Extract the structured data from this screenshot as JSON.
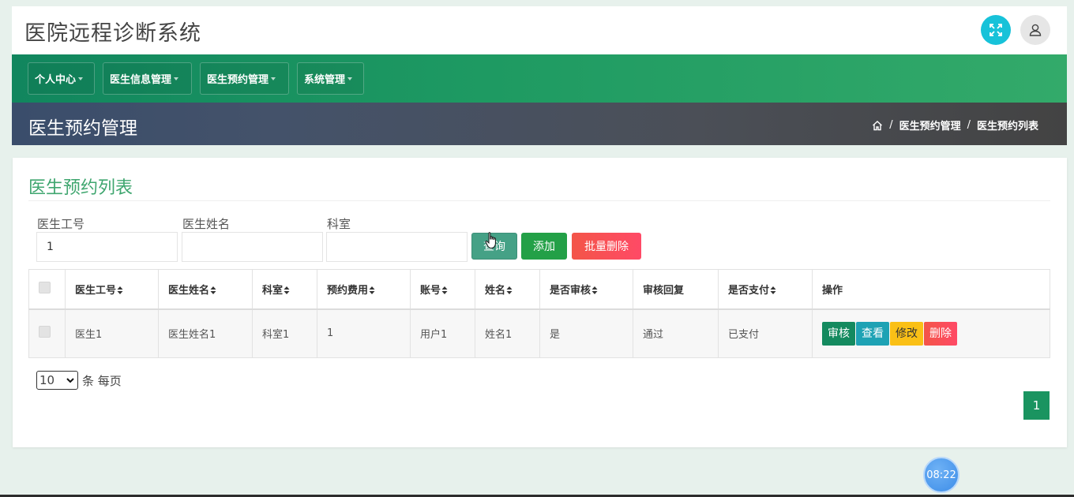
{
  "app": {
    "title": "医院远程诊断系统"
  },
  "nav": {
    "items": [
      {
        "label": "个人中心"
      },
      {
        "label": "医生信息管理"
      },
      {
        "label": "医生预约管理"
      },
      {
        "label": "系统管理"
      }
    ]
  },
  "page_header": {
    "title": "医生预约管理",
    "breadcrumb": [
      "医生预约管理",
      "医生预约列表"
    ]
  },
  "card": {
    "title": "医生预约列表",
    "filters": [
      {
        "label": "医生工号",
        "value": "1",
        "placeholder": ""
      },
      {
        "label": "医生姓名",
        "value": "",
        "placeholder": ""
      },
      {
        "label": "科室",
        "value": "",
        "placeholder": ""
      }
    ],
    "buttons": {
      "search": "查询",
      "add": "添加",
      "batch_delete": "批量删除"
    }
  },
  "table": {
    "columns": [
      "医生工号",
      "医生姓名",
      "科室",
      "预约费用",
      "账号",
      "姓名",
      "是否审核",
      "审核回复",
      "是否支付",
      "操作"
    ],
    "rows": [
      {
        "doctor_id": "医生1",
        "doctor_name": "医生姓名1",
        "department": "科室1",
        "fee": "1",
        "account": "用户1",
        "name": "姓名1",
        "audited": "是",
        "audit_reply": "通过",
        "paid": "已支付",
        "actions": {
          "audit": "审核",
          "view": "查看",
          "edit": "修改",
          "delete": "删除"
        }
      }
    ]
  },
  "pagination": {
    "page_size": "10",
    "per_page_text": "条 每页",
    "current_page": "1"
  },
  "clock": {
    "time": "08:22"
  },
  "colors": {
    "brand_green": "#1e9a62",
    "title_green": "#3fa66f",
    "header_dark": "#434343",
    "accent_cyan": "#17c2d9",
    "danger": "#ff4a66",
    "warning": "#fac016"
  }
}
